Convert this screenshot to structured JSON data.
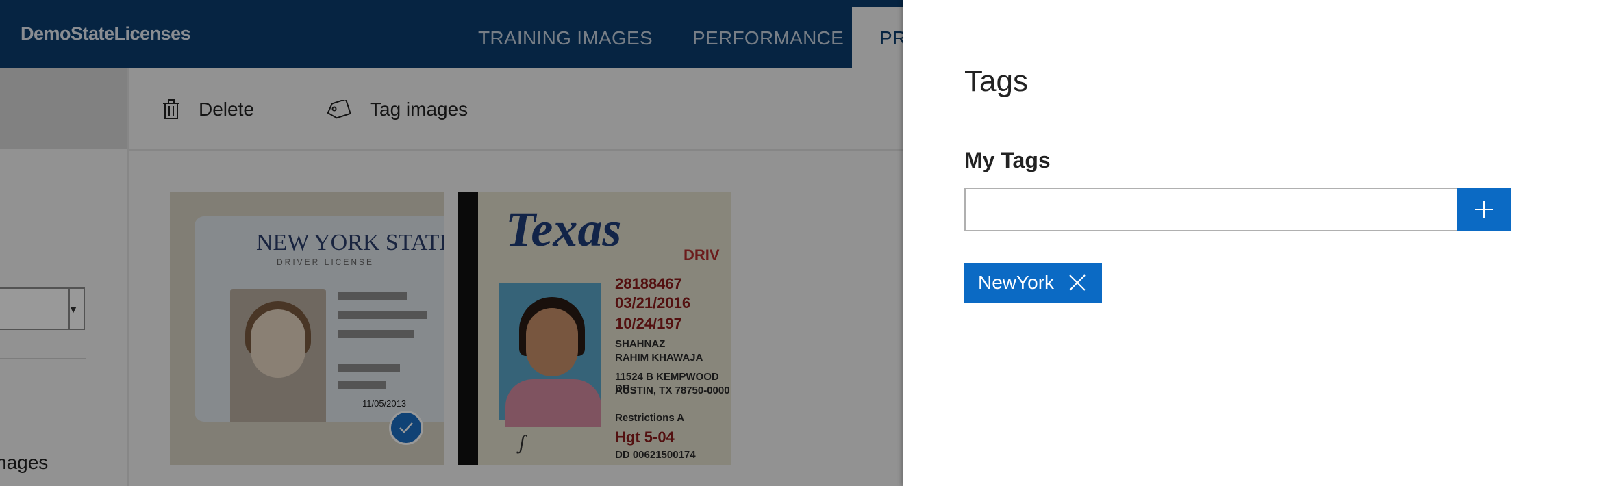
{
  "app": {
    "title": "DemoStateLicenses"
  },
  "nav": {
    "tabs": [
      {
        "label": "TRAINING IMAGES"
      },
      {
        "label": "PERFORMANCE"
      },
      {
        "label": "PR"
      }
    ]
  },
  "toolbar": {
    "delete_label": "Delete",
    "tag_images_label": "Tag images"
  },
  "left_pane": {
    "images_label": "nages"
  },
  "gallery": {
    "images": [
      {
        "title": "NEW YORK STATE",
        "subtitle": "DRIVER LICENSE",
        "date": "11/05/2013",
        "selected": true
      },
      {
        "title": "Texas",
        "banner": "DRIV",
        "lines": [
          "28188467",
          "03/21/2016",
          "10/24/197",
          "SHAHNAZ",
          "RAHIM KHAWAJA",
          "11524 B KEMPWOOD DR",
          "AUSTIN, TX 78750-0000",
          "Restrictions A",
          "Hgt 5-04",
          "DD 00621500174"
        ],
        "selected": false
      }
    ]
  },
  "tags_panel": {
    "title": "Tags",
    "section_label": "My Tags",
    "input": {
      "value": "",
      "placeholder": ""
    },
    "add_icon": "plus-icon",
    "tags": [
      {
        "label": "NewYork"
      }
    ]
  },
  "colors": {
    "topbar": "#0a3d6e",
    "accent": "#0b6ac4",
    "panel_bg": "#ffffff"
  }
}
